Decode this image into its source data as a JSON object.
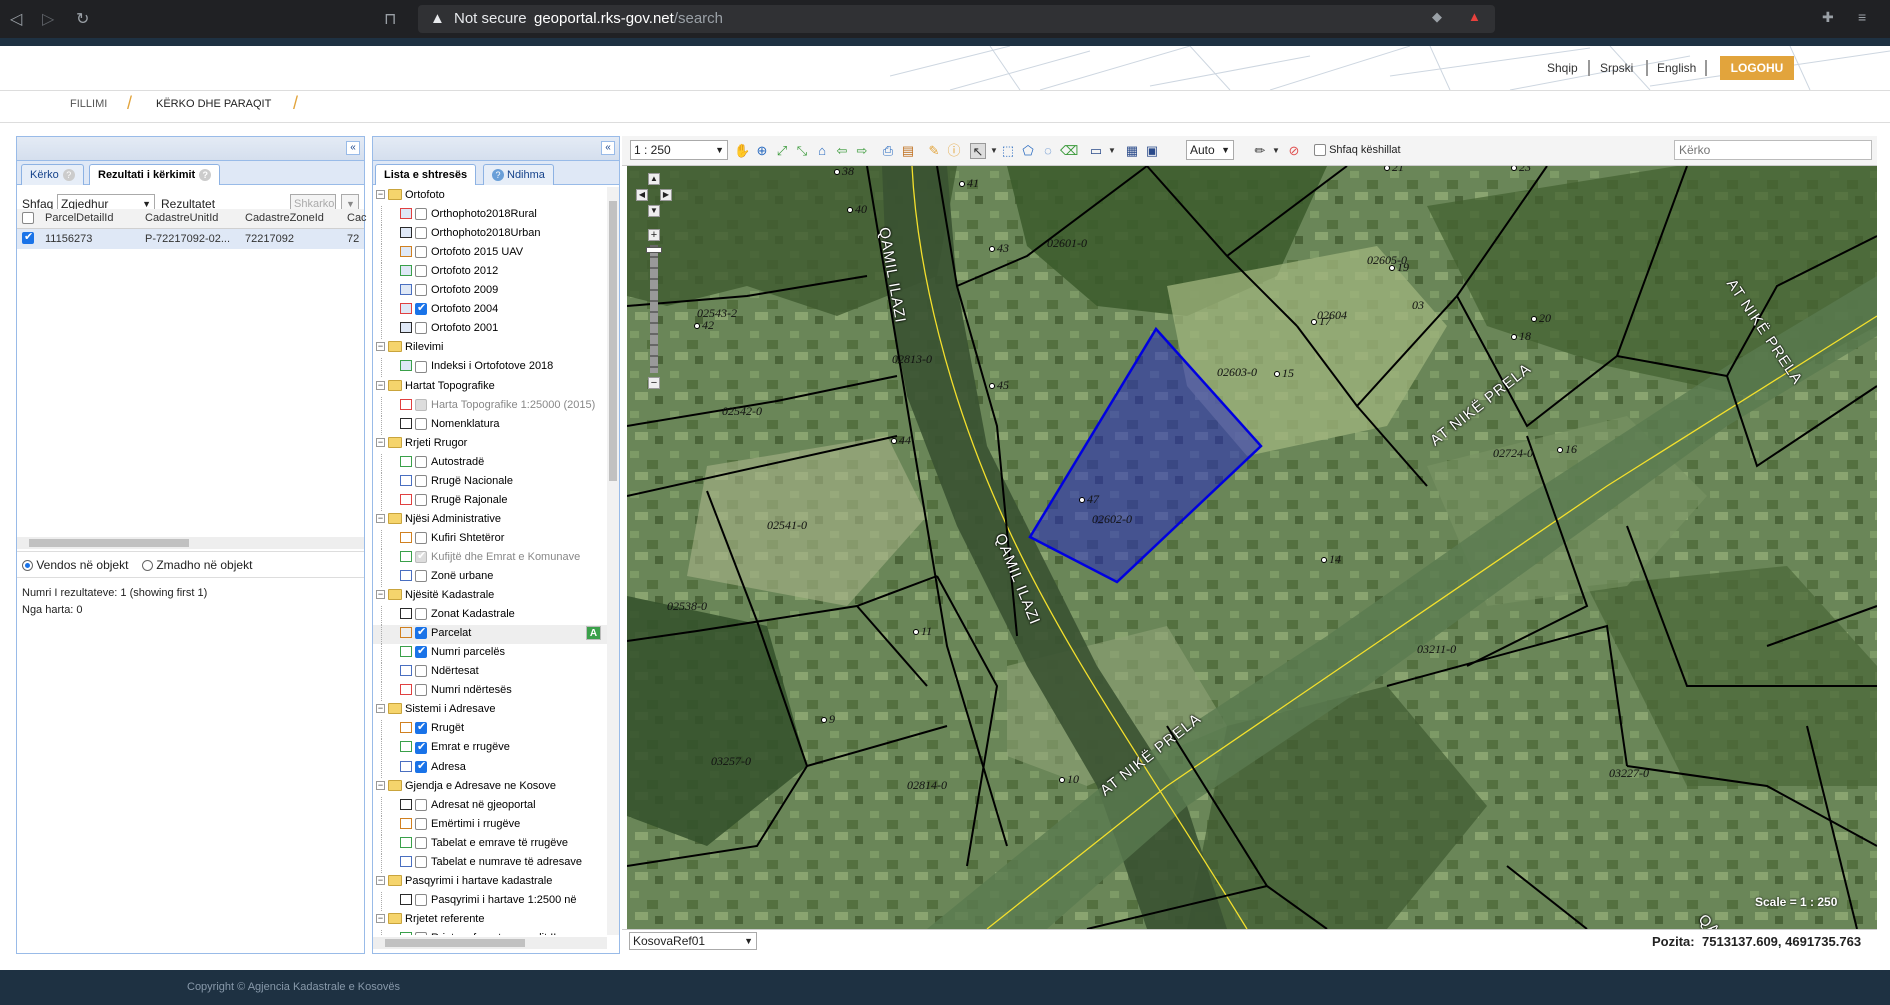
{
  "browser": {
    "not_secure": "Not secure",
    "host": "geoportal.rks-gov.net",
    "path": "/search"
  },
  "header": {
    "languages": [
      "Shqip",
      "Srpski",
      "English"
    ],
    "login": "LOGOHU"
  },
  "breadcrumb": {
    "items": [
      "FILLIMI",
      "KËRKO DHE PARAQIT"
    ]
  },
  "left_panel": {
    "tabs": [
      "Kërko",
      "Rezultati i kërkimit"
    ],
    "show_label": "Shfaq",
    "show_value": "Zgjedhur",
    "results_label": "Rezultatet",
    "clear_btn": "Shkarko",
    "columns": [
      "ParcelDetailId",
      "CadastreUnitId",
      "CadastreZoneId",
      "Cac"
    ],
    "rows": [
      [
        "11156273",
        "P-72217092-02...",
        "72217092",
        "72"
      ]
    ],
    "radio_place": "Vendos në objekt",
    "radio_zoom": "Zmadho në objekt",
    "summary": "Numri I rezultateve: 1 (showing first 1)",
    "from_map": "Nga harta: 0"
  },
  "layers_panel": {
    "tabs": [
      "Lista e shtresës",
      "Ndihma"
    ],
    "layers": [
      {
        "t": "g",
        "label": "Ortofoto"
      },
      {
        "t": "l",
        "label": "Orthophoto2018Rural",
        "on": false
      },
      {
        "t": "l",
        "label": "Orthophoto2018Urban",
        "on": false
      },
      {
        "t": "l",
        "label": "Ortofoto 2015 UAV",
        "on": false
      },
      {
        "t": "l",
        "label": "Ortofoto 2012",
        "on": false
      },
      {
        "t": "l",
        "label": "Ortofoto 2009",
        "on": false
      },
      {
        "t": "l",
        "label": "Ortofoto 2004",
        "on": true
      },
      {
        "t": "l",
        "label": "Ortofoto 2001",
        "on": false
      },
      {
        "t": "g",
        "label": "Rilevimi"
      },
      {
        "t": "l",
        "label": "Indeksi i Ortofotove 2018",
        "on": false
      },
      {
        "t": "g",
        "label": "Hartat Topografike"
      },
      {
        "t": "l",
        "label": "Harta Topografike 1:25000 (2015)",
        "on": false,
        "dis": true
      },
      {
        "t": "l",
        "label": "Nomenklatura",
        "on": false
      },
      {
        "t": "g",
        "label": "Rrjeti Rrugor"
      },
      {
        "t": "l",
        "label": "Autostradë",
        "on": false
      },
      {
        "t": "l",
        "label": "Rrugë Nacionale",
        "on": false
      },
      {
        "t": "l",
        "label": "Rrugë Rajonale",
        "on": false
      },
      {
        "t": "g",
        "label": "Njësi Administrative"
      },
      {
        "t": "l",
        "label": "Kufiri Shtetëror",
        "on": false
      },
      {
        "t": "l",
        "label": "Kufijtë dhe Emrat e Komunave",
        "on": true,
        "dis": true
      },
      {
        "t": "l",
        "label": "Zonë urbane",
        "on": false
      },
      {
        "t": "g",
        "label": "Njësitë Kadastrale"
      },
      {
        "t": "l",
        "label": "Zonat Kadastrale",
        "on": false
      },
      {
        "t": "l",
        "label": "Parcelat",
        "on": true,
        "active": true
      },
      {
        "t": "l",
        "label": "Numri parcelës",
        "on": true
      },
      {
        "t": "l",
        "label": "Ndërtesat",
        "on": false
      },
      {
        "t": "l",
        "label": "Numri ndërtesës",
        "on": false
      },
      {
        "t": "g",
        "label": "Sistemi i Adresave"
      },
      {
        "t": "l",
        "label": "Rrugët",
        "on": true
      },
      {
        "t": "l",
        "label": "Emrat e rrugëve",
        "on": true
      },
      {
        "t": "l",
        "label": "Adresa",
        "on": true
      },
      {
        "t": "g",
        "label": "Gjendja e Adresave ne Kosove"
      },
      {
        "t": "l",
        "label": "Adresat në gjeoportal",
        "on": false
      },
      {
        "t": "l",
        "label": "Emërtimi i rrugëve",
        "on": false
      },
      {
        "t": "l",
        "label": "Tabelat e emrave të rrugëve",
        "on": false
      },
      {
        "t": "l",
        "label": "Tabelat e numrave të adresave",
        "on": false
      },
      {
        "t": "g",
        "label": "Pasqyrimi i hartave kadastrale"
      },
      {
        "t": "l",
        "label": "Pasqyrimi i hartave 1:2500 në",
        "on": false
      },
      {
        "t": "g",
        "label": "Rrjetet referente"
      },
      {
        "t": "l",
        "label": "Rrjeta referente e rendit II",
        "on": false
      }
    ]
  },
  "map": {
    "scale_select": "1 : 250",
    "auto": "Auto",
    "tips": "Shfaq këshillat",
    "search_placeholder": "Kërko",
    "scale_text": "Scale = 1 : 250",
    "crs": "KosovaRef01",
    "pos_label": "Pozita:",
    "pos_value": "7513137.609, 4691735.763",
    "labels": [
      "38",
      "41",
      "40",
      "43",
      "02601-0",
      "02605-0",
      "19",
      "02543-2",
      "42",
      "02813-0",
      "45",
      "02603-0",
      "15",
      "02602-0",
      "47",
      "17",
      "20",
      "18",
      "02542-0",
      "44",
      "02724-0",
      "16",
      "02541-0",
      "14",
      "02538-0",
      "11",
      "03211-0",
      "9",
      "03257-0",
      "10",
      "02814-0",
      "03227-0",
      "03",
      "02604",
      "21",
      "23"
    ],
    "streets": [
      "QAMIL ILAZI",
      "QAMIL ILAZI",
      "AT NIKË PRELA",
      "AT NIKË PRELA",
      "AT NIKË PRELA",
      "QAMIL ILAZI"
    ]
  },
  "footer": {
    "copyright": "Copyright © Agjencia Kadastrale e Kosovës"
  },
  "colors": {
    "accent": "#e2a43c",
    "header_dark": "#1e3142",
    "selection": "#2020c8"
  }
}
